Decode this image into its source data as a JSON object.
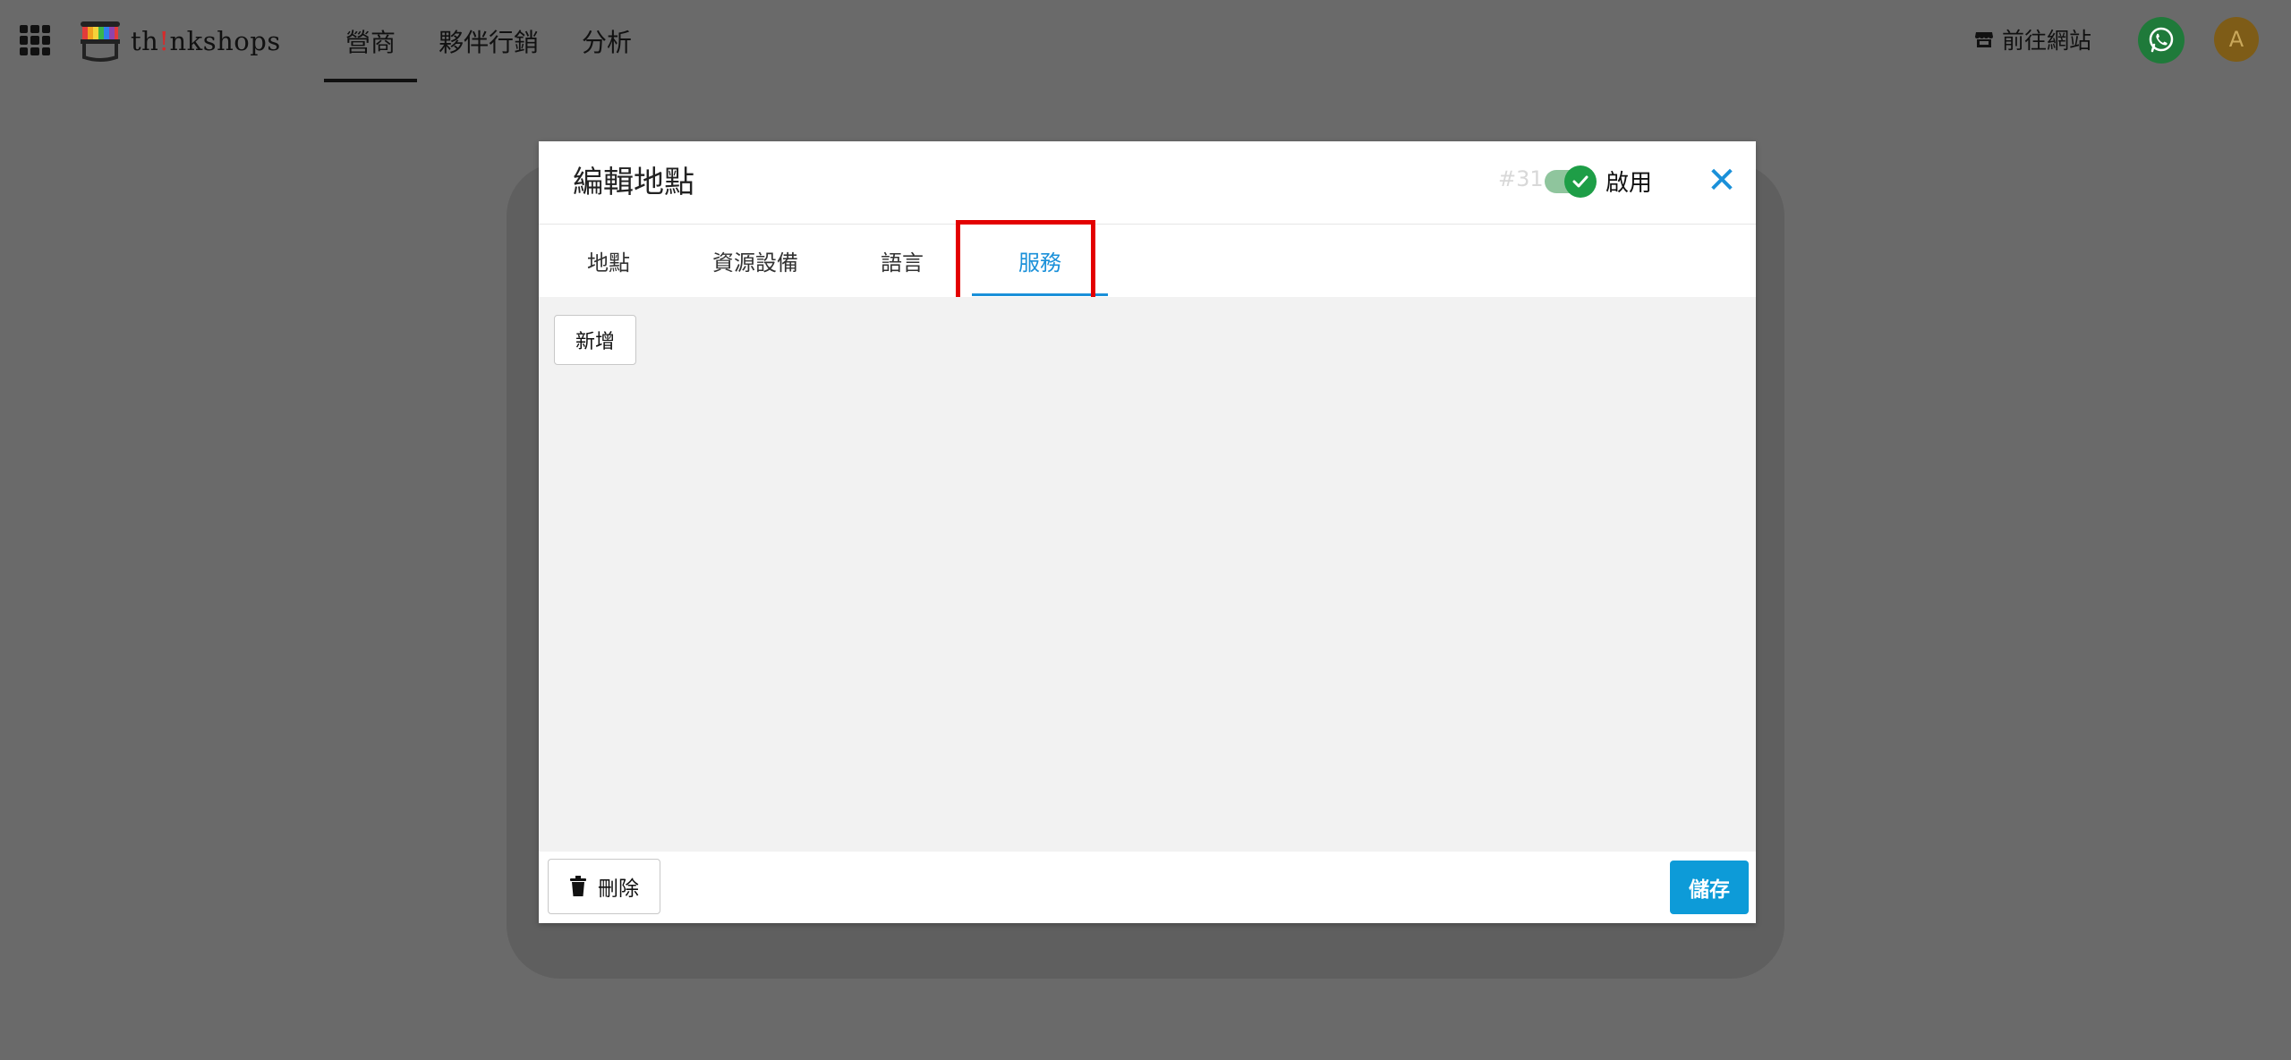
{
  "header": {
    "app_name_prefix": "th",
    "app_name_bang": "!",
    "app_name_suffix": "nkshops",
    "nav_tabs": [
      {
        "label": "營商"
      },
      {
        "label": "夥伴行銷"
      },
      {
        "label": "分析"
      }
    ],
    "goto_site_label": "前往網站",
    "avatar_initial": "A"
  },
  "modal": {
    "title": "編輯地點",
    "record_id": "#31",
    "enabled_label": "啟用",
    "enabled": true,
    "close_glyph": "✕",
    "tabs": [
      {
        "label": "地點"
      },
      {
        "label": "資源設備"
      },
      {
        "label": "語言"
      },
      {
        "label": "服務"
      }
    ],
    "active_tab": "服務",
    "add_label": "新增",
    "delete_label": "刪除",
    "save_label": "儲存"
  },
  "colors": {
    "overlay": "#6a6a6a",
    "accent": "#1a90d9",
    "save_button": "#0d9bd8",
    "toggle_on": "#1e9e47",
    "highlight": "#e30000"
  },
  "icons": [
    "apps-grid-icon",
    "store-icon",
    "whatsapp-icon",
    "check-icon",
    "close-icon",
    "trash-icon"
  ]
}
